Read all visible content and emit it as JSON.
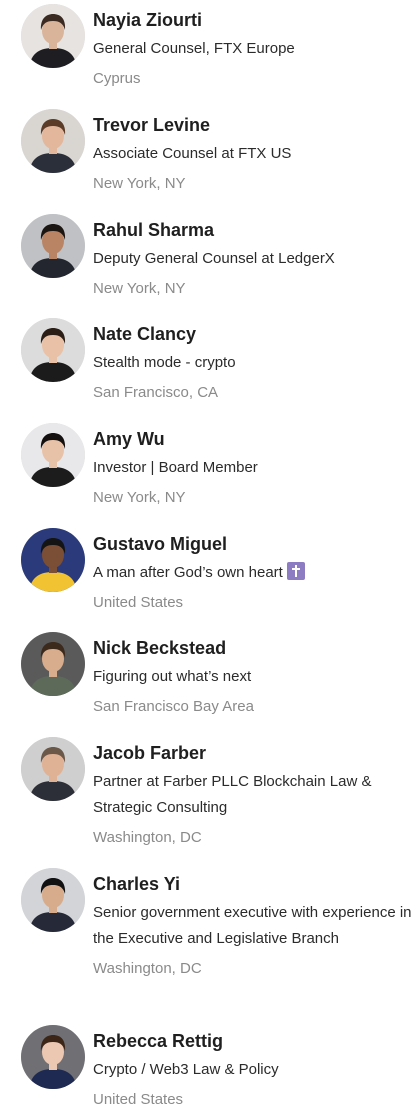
{
  "people": [
    {
      "name": "Nayia Ziourti",
      "headline": "General Counsel, FTX Europe",
      "location": "Cyprus",
      "avatar": {
        "bg": "#e6e3e0",
        "skin": "#d9b49a",
        "hair": "#3a2a22",
        "clothes": "#1e1e22"
      }
    },
    {
      "name": "Trevor Levine",
      "headline": "Associate Counsel at FTX US",
      "location": "New York, NY",
      "avatar": {
        "bg": "#d9d6d2",
        "skin": "#e2b79c",
        "hair": "#5a3c28",
        "clothes": "#2b2f3a"
      }
    },
    {
      "name": "Rahul Sharma",
      "headline": "Deputy General Counsel at LedgerX",
      "location": "New York, NY",
      "avatar": {
        "bg": "#bfc1c4",
        "skin": "#b98464",
        "hair": "#1c1612",
        "clothes": "#23262e"
      }
    },
    {
      "name": "Nate Clancy",
      "headline": "Stealth mode - crypto",
      "location": "San Francisco, CA",
      "avatar": {
        "bg": "#dcdcdc",
        "skin": "#e9c1a6",
        "hair": "#2a1e16",
        "clothes": "#1b1b1b"
      }
    },
    {
      "name": "Amy Wu",
      "headline": "Investor | Board Member",
      "location": "New York, NY",
      "avatar": {
        "bg": "#e8e8ea",
        "skin": "#e8c2a8",
        "hair": "#141010",
        "clothes": "#1c1c1c"
      }
    },
    {
      "name": "Gustavo Miguel",
      "headline": "A man after God’s own heart",
      "location": "United States",
      "avatar": {
        "bg": "#2a3a7a",
        "skin": "#7b4e36",
        "hair": "#141414",
        "clothes": "#f1c232"
      }
    },
    {
      "name": "Nick Beckstead",
      "headline": "Figuring out what’s next",
      "location": "San Francisco Bay Area",
      "avatar": {
        "bg": "#5a5a5a",
        "skin": "#d8ad8e",
        "hair": "#3c2a1c",
        "clothes": "#5d6a5a"
      }
    },
    {
      "name": "Jacob Farber",
      "headline": "Partner at Farber PLLC Blockchain Law & Strategic Consulting",
      "location": "Washington, DC",
      "avatar": {
        "bg": "#cfcfcf",
        "skin": "#e0b295",
        "hair": "#6b5848",
        "clothes": "#2d2f38"
      }
    },
    {
      "name": "Charles Yi",
      "headline": "Senior government executive with experience in the Executive and Legislative Branch",
      "location": "Washington, DC",
      "avatar": {
        "bg": "#d2d4d8",
        "skin": "#d7ac8c",
        "hair": "#111111",
        "clothes": "#262a38"
      }
    },
    {
      "name": "Rebecca Rettig",
      "headline": "Crypto / Web3 Law & Policy",
      "location": "United States",
      "avatar": {
        "bg": "#6f6f74",
        "skin": "#ecc8b2",
        "hair": "#3b2618",
        "clothes": "#1f2a52"
      }
    }
  ]
}
